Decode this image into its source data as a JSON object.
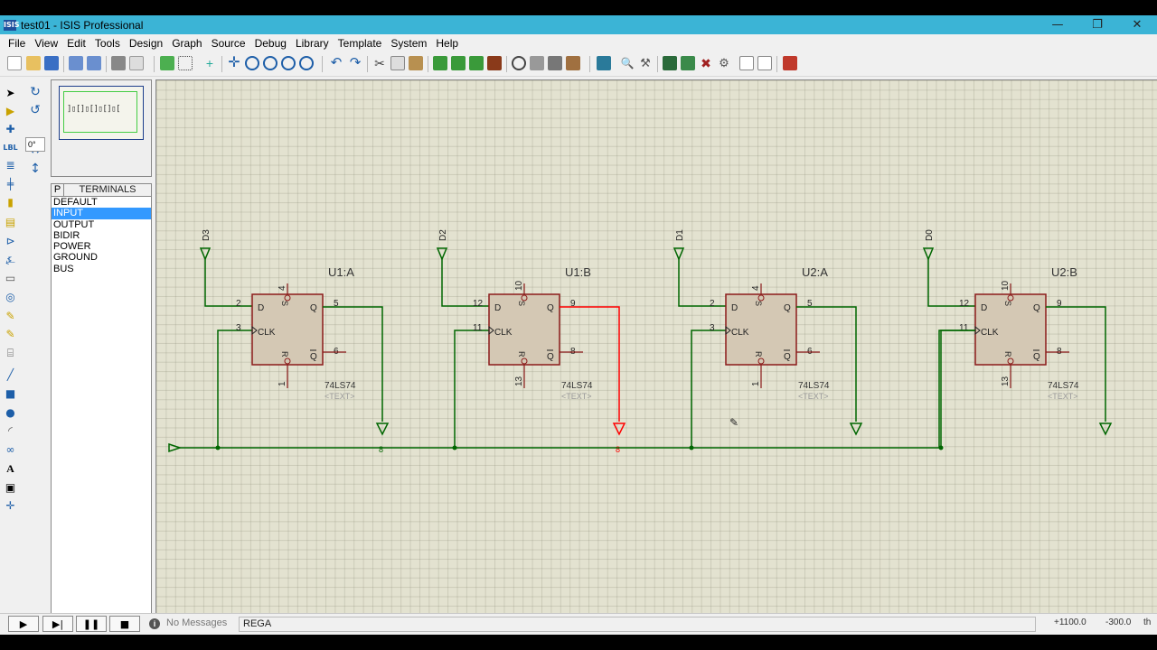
{
  "window": {
    "app_icon": "ISIS",
    "title": "test01 - ISIS Professional",
    "minimize": "—",
    "restore": "❐",
    "close": "✕"
  },
  "menu": [
    "File",
    "Edit",
    "Edit",
    "Tools",
    "Design",
    "Graph",
    "Source",
    "Debug",
    "Library",
    "Template",
    "System",
    "Help"
  ],
  "menu_items": [
    "File",
    "View",
    "Edit",
    "Tools",
    "Design",
    "Graph",
    "Source",
    "Debug",
    "Library",
    "Template",
    "System",
    "Help"
  ],
  "rotation": {
    "angle": "0°"
  },
  "terminals": {
    "p_button": "P",
    "header": "TERMINALS",
    "items": [
      "DEFAULT",
      "INPUT",
      "OUTPUT",
      "BIDIR",
      "POWER",
      "GROUND",
      "BUS"
    ],
    "selected": "INPUT"
  },
  "schematic": {
    "inputs": [
      "D3",
      "D2",
      "D1",
      "D0"
    ],
    "flipflops": [
      {
        "name": "U1:A",
        "pin_d": "2",
        "pin_clk": "3",
        "pin_q": "5",
        "pin_qbar": "6",
        "pin_s": "4",
        "pin_r": "1",
        "part": "74LS74",
        "text": "<TEXT>"
      },
      {
        "name": "U1:B",
        "pin_d": "12",
        "pin_clk": "11",
        "pin_q": "9",
        "pin_qbar": "8",
        "pin_s": "10",
        "pin_r": "13",
        "part": "74LS74",
        "text": "<TEXT>"
      },
      {
        "name": "U2:A",
        "pin_d": "2",
        "pin_clk": "3",
        "pin_q": "5",
        "pin_qbar": "6",
        "pin_s": "4",
        "pin_r": "1",
        "part": "74LS74",
        "text": "<TEXT>"
      },
      {
        "name": "U2:B",
        "pin_d": "12",
        "pin_clk": "11",
        "pin_q": "9",
        "pin_qbar": "8",
        "pin_s": "10",
        "pin_r": "13",
        "part": "74LS74",
        "text": "<TEXT>"
      }
    ],
    "labels": {
      "d": "D",
      "clk": "CLK",
      "q": "Q",
      "qbar": "Q",
      "s": "S",
      "r": "R"
    },
    "highlight_color": "#ff0000",
    "wire_color": "#006600",
    "component_fill": "#d4c8b4",
    "component_border": "#8b1a1a"
  },
  "status": {
    "message_icon": "i",
    "message": "No Messages",
    "sheet": "REGA",
    "x": "+1100.0",
    "y": "-300.0",
    "unit": "th"
  }
}
